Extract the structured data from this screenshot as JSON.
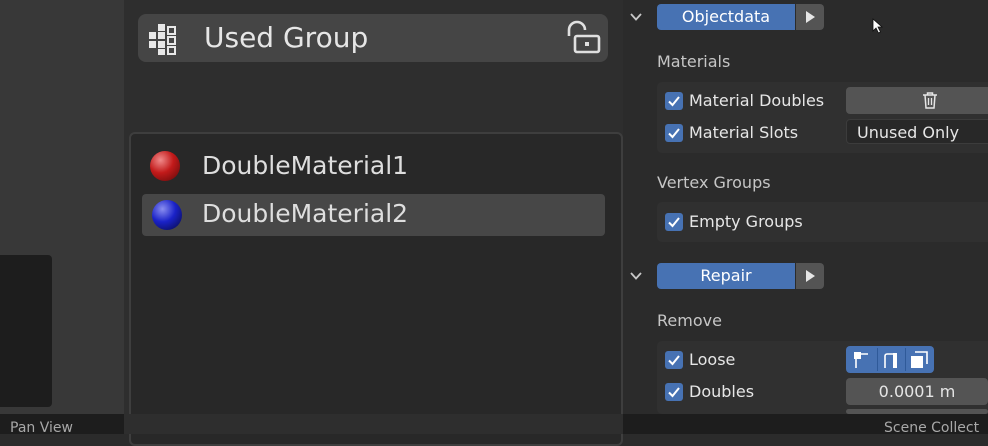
{
  "popup": {
    "group_title": "Used Group",
    "group_icon": "grid-cubes-icon",
    "lock_icon": "unlock-icon",
    "materials": [
      {
        "name": "DoubleMaterial1",
        "color": "#c21a1a",
        "selected": false
      },
      {
        "name": "DoubleMaterial2",
        "color": "#1a22c8",
        "selected": true
      }
    ]
  },
  "panel": {
    "objectdata": {
      "title": "Objectdata",
      "sections": {
        "materials": {
          "label": "Materials",
          "material_doubles": {
            "label": "Material Doubles",
            "checked": true,
            "action_icon": "trash-icon"
          },
          "material_slots": {
            "label": "Material Slots",
            "checked": true,
            "value": "Unused Only"
          }
        },
        "vertex_groups": {
          "label": "Vertex Groups",
          "empty_groups": {
            "label": "Empty Groups",
            "checked": true
          }
        }
      }
    },
    "repair": {
      "title": "Repair",
      "sections": {
        "remove": {
          "label": "Remove",
          "loose": {
            "label": "Loose",
            "checked": true,
            "mode_icons": [
              "vertex-select-icon",
              "edge-select-icon",
              "face-select-icon"
            ]
          },
          "doubles": {
            "label": "Doubles",
            "checked": true,
            "value": "0.0001 m"
          }
        }
      }
    }
  },
  "statusbar": {
    "left": "Pan View",
    "right": "Scene Collect"
  },
  "colors": {
    "accent": "#4772b3",
    "background": "#2b2b2b"
  }
}
